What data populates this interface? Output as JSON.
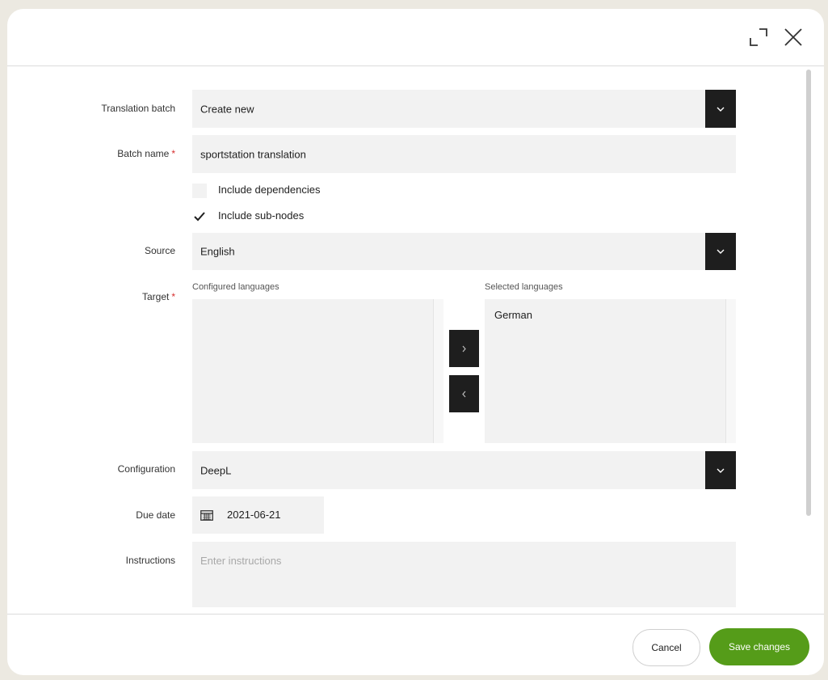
{
  "dialog": {
    "header": {
      "maximize_icon": "maximize-icon",
      "close_icon": "close-icon"
    },
    "form": {
      "translation_batch": {
        "label": "Translation batch",
        "value": "Create new"
      },
      "batch_name": {
        "label": "Batch name",
        "required_mark": "*",
        "value": "sportstation translation"
      },
      "include_dependencies": {
        "label": "Include dependencies",
        "checked": false
      },
      "include_subnodes": {
        "label": "Include sub-nodes",
        "checked": true
      },
      "source": {
        "label": "Source",
        "value": "English"
      },
      "target": {
        "label": "Target",
        "required_mark": "*",
        "configured_label": "Configured languages",
        "configured_items": [],
        "selected_label": "Selected languages",
        "selected_items": [
          "German"
        ],
        "move_right_icon": "chevron-right-icon",
        "move_left_icon": "chevron-left-icon"
      },
      "configuration": {
        "label": "Configuration",
        "value": "DeepL"
      },
      "due_date": {
        "label": "Due date",
        "value": "2021-06-21",
        "icon": "calendar-icon"
      },
      "instructions": {
        "label": "Instructions",
        "placeholder": "Enter instructions",
        "value": ""
      }
    },
    "footer": {
      "cancel_label": "Cancel",
      "save_label": "Save changes"
    }
  },
  "colors": {
    "accent_green": "#559c19",
    "dark_button": "#1e1e1e",
    "field_bg": "#f2f2f2",
    "required": "#d62d2d"
  }
}
